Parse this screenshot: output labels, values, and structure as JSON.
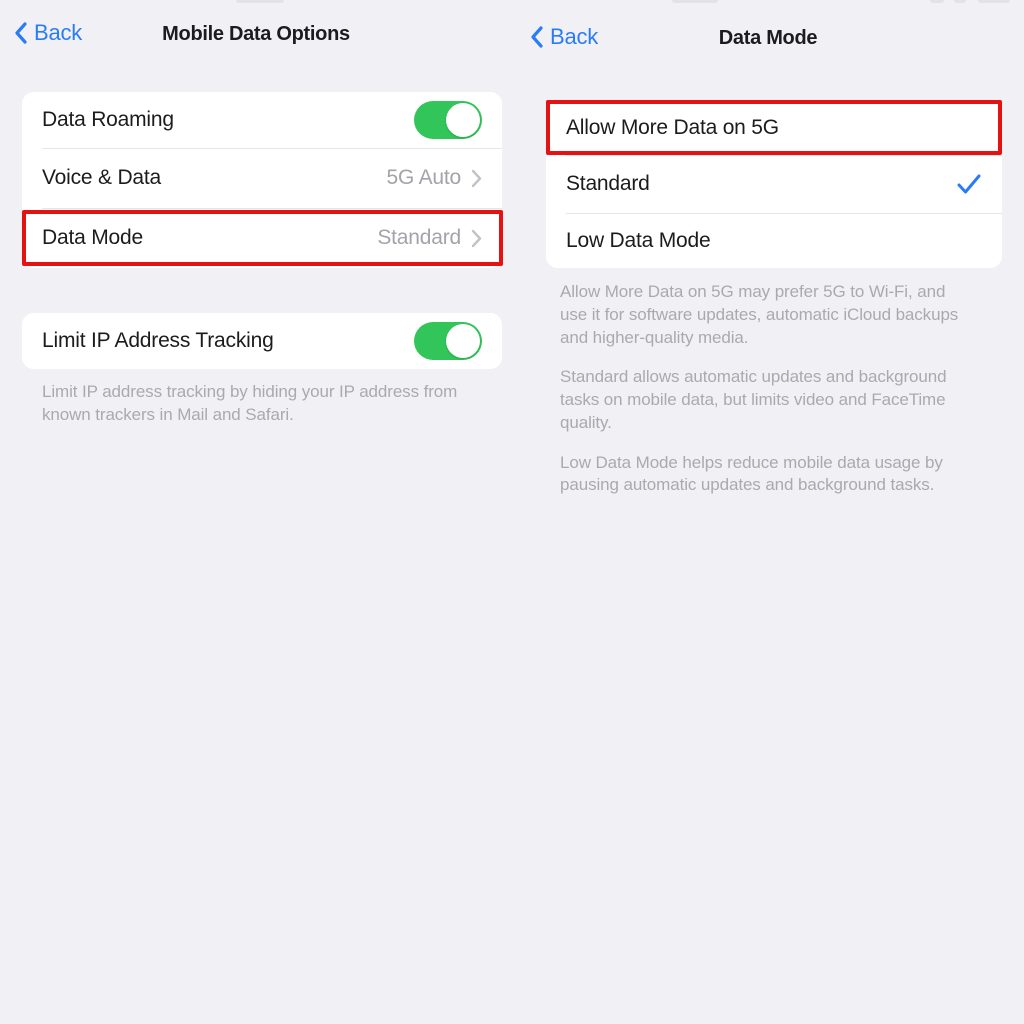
{
  "left_screen": {
    "nav": {
      "back_label": "Back",
      "back_icon": "chevron-left-icon",
      "title": "Mobile Data Options"
    },
    "group_1": {
      "rows": [
        {
          "label": "Data Roaming",
          "control": "toggle",
          "toggle_on": true
        },
        {
          "label": "Voice & Data",
          "value": "5G Auto",
          "control": "disclosure"
        },
        {
          "label": "Data Mode",
          "value": "Standard",
          "control": "disclosure",
          "highlighted": true
        }
      ]
    },
    "group_2": {
      "rows": [
        {
          "label": "Limit IP Address Tracking",
          "control": "toggle",
          "toggle_on": true
        }
      ],
      "footer": "Limit IP address tracking by hiding your IP address from known trackers in Mail and Safari."
    }
  },
  "right_screen": {
    "nav": {
      "back_label": "Back",
      "back_icon": "chevron-left-icon",
      "title": "Data Mode"
    },
    "options": {
      "rows": [
        {
          "label": "Allow More Data on 5G",
          "selected": false,
          "highlighted": true
        },
        {
          "label": "Standard",
          "selected": true,
          "highlighted": false
        },
        {
          "label": "Low Data Mode",
          "selected": false,
          "highlighted": false
        }
      ],
      "footer_paragraphs": [
        "Allow More Data on 5G may prefer 5G to Wi-Fi, and use it for software updates, automatic iCloud backups and higher-quality media.",
        "Standard allows automatic updates and background tasks on mobile data, but limits video and FaceTime quality.",
        "Low Data Mode helps reduce mobile data usage by pausing automatic updates and background tasks."
      ]
    }
  },
  "colors": {
    "background": "#f1f1f5",
    "card": "#ffffff",
    "accent_blue": "#2a7cf6",
    "toggle_green": "#32c65a",
    "annotation_red": "#e51212",
    "secondary_text": "#a3a3a9",
    "primary_text": "#1c1c1e"
  }
}
